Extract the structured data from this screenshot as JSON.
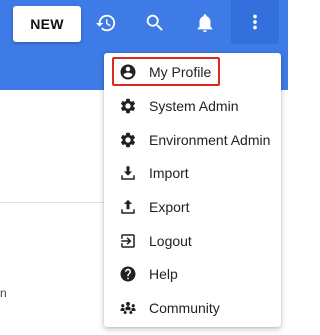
{
  "toolbar": {
    "new_label": "NEW",
    "icons": [
      "history-icon",
      "search-icon",
      "bell-icon",
      "more-vert-icon"
    ]
  },
  "background": {
    "partial_text": "n"
  },
  "menu": {
    "items": [
      {
        "label": "My Profile",
        "icon": "account-circle-icon",
        "highlighted": true
      },
      {
        "label": "System Admin",
        "icon": "gear-icon"
      },
      {
        "label": "Environment Admin",
        "icon": "gear-icon"
      },
      {
        "label": "Import",
        "icon": "download-icon"
      },
      {
        "label": "Export",
        "icon": "upload-icon"
      },
      {
        "label": "Logout",
        "icon": "logout-icon"
      },
      {
        "label": "Help",
        "icon": "help-circle-icon"
      },
      {
        "label": "Community",
        "icon": "people-icon"
      }
    ]
  },
  "colors": {
    "topbar": "#3f7be6",
    "more_button": "#3470dd",
    "highlight_border": "#d92b1f",
    "icon": "#222222"
  }
}
